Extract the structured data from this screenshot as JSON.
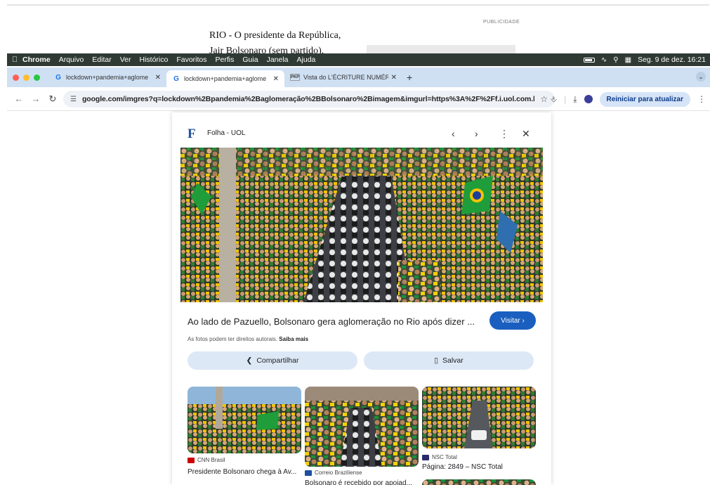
{
  "background_article": {
    "publicidade": "PUBLICIDADE",
    "line1": "RIO - O presidente da República,",
    "line2": "Jair Bolsonaro (sem partido),"
  },
  "menubar": {
    "app": "Chrome",
    "items": [
      "Arquivo",
      "Editar",
      "Ver",
      "Histórico",
      "Favoritos",
      "Perfis",
      "Guia",
      "Janela",
      "Ajuda"
    ],
    "datetime": "Seg. 9 de dez.  16:21"
  },
  "tabs": [
    {
      "title": "lockdown+pandemia+aglome",
      "favicon": "G",
      "active": false
    },
    {
      "title": "lockdown+pandemia+aglome",
      "favicon": "G",
      "active": true
    },
    {
      "title": "Vista do L'ÉCRITURE NUMÉR",
      "favicon": "PKP",
      "active": false
    }
  ],
  "toolbar": {
    "url": "google.com/imgres?q=lockdown%2Bpandemia%2Baglomeração%2BBolsonaro%2Bimagem&imgurl=https%3A%2F%2Ff.i.uol.com.br%2...",
    "update_label": "Reiniciar para atualizar"
  },
  "viewer": {
    "source_logo": "F",
    "source_name": "Folha - UOL",
    "caption": "Ao lado de Pazuello, Bolsonaro gera aglomeração no Rio após dizer ...",
    "visit_label": "Visitar ›",
    "rights_text": "As fotos podem ter direitos autorais.",
    "rights_link": "Saiba mais",
    "share_label": "Compartilhar",
    "save_label": "Salvar"
  },
  "related": [
    {
      "source": "CNN Brasil",
      "title": "Presidente Bolsonaro chega à Av...",
      "source_color": "#cc0000"
    },
    {
      "source": "Correio Braziliense",
      "title": "Bolsonaro é recebido por apoiad...",
      "source_color": "#1d4fa0"
    },
    {
      "source": "NSC Total",
      "title": "Página: 2849 – NSC Total",
      "source_color": "#2b2b6b"
    }
  ],
  "colors": {
    "accent": "#1a5fbf",
    "menubar": "#2f3a35",
    "tabstrip": "#cfe0f3",
    "button_bg": "#dde8f6"
  }
}
